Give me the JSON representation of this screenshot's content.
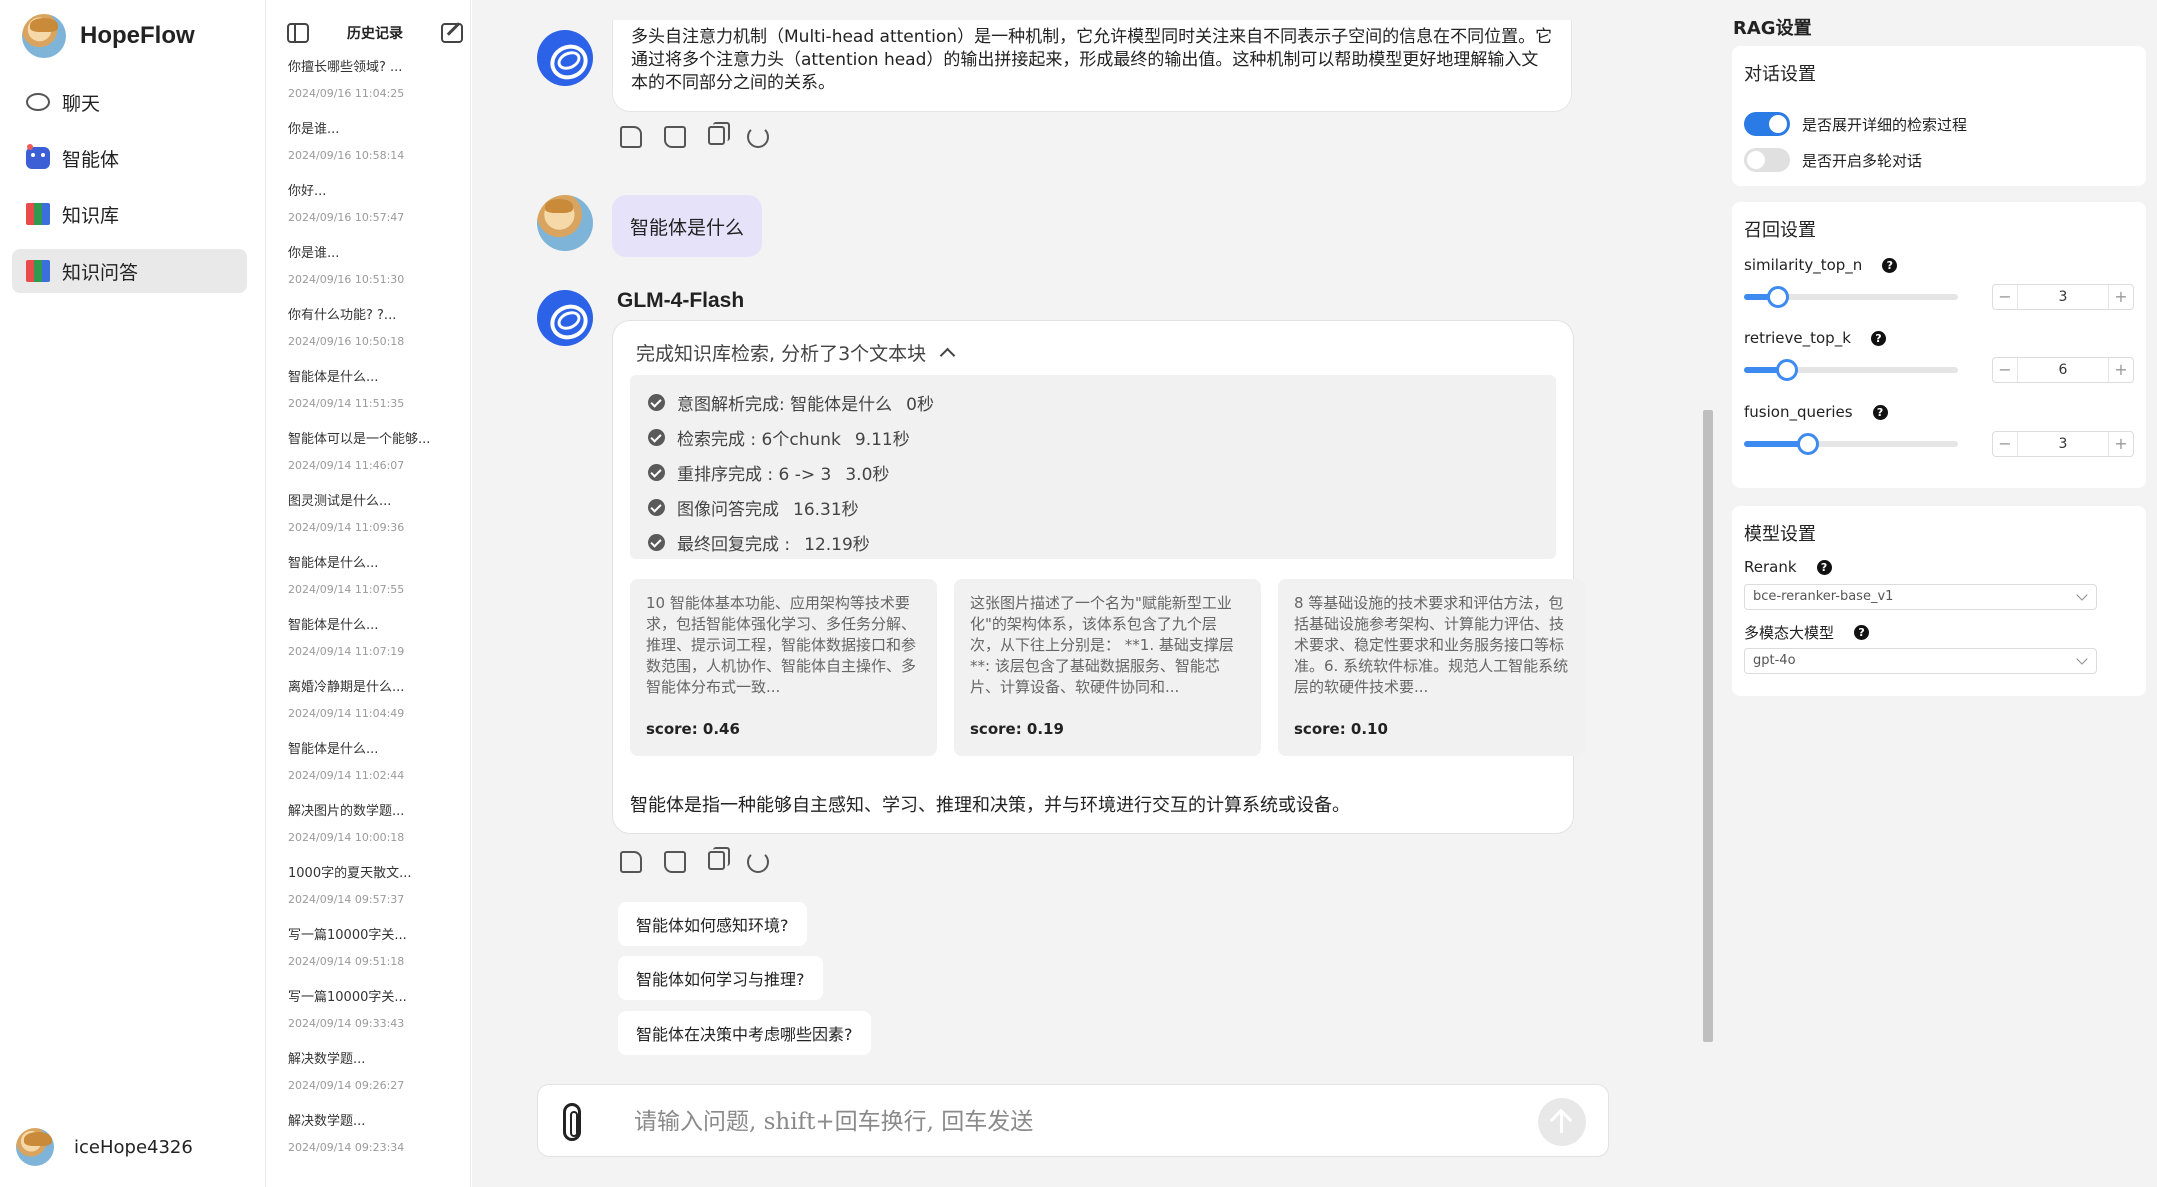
{
  "app": {
    "name": "HopeFlow"
  },
  "nav": {
    "items": [
      {
        "label": "聊天",
        "icon": "chat-icon"
      },
      {
        "label": "智能体",
        "icon": "robot-icon"
      },
      {
        "label": "知识库",
        "icon": "books-icon"
      },
      {
        "label": "知识问答",
        "icon": "books-icon",
        "active": true
      }
    ],
    "user": "iceHope4326"
  },
  "history": {
    "title": "历史记录",
    "items": [
      {
        "q": "你擅长哪些领域? ...",
        "t": "2024/09/16 11:04:25"
      },
      {
        "q": "你是谁...",
        "t": "2024/09/16 10:58:14"
      },
      {
        "q": "你好...",
        "t": "2024/09/16 10:57:47"
      },
      {
        "q": "你是谁...",
        "t": "2024/09/16 10:51:30"
      },
      {
        "q": "你有什么功能? ?...",
        "t": "2024/09/16 10:50:18"
      },
      {
        "q": "智能体是什么...",
        "t": "2024/09/14 11:51:35"
      },
      {
        "q": "智能体可以是一个能够...",
        "t": "2024/09/14 11:46:07"
      },
      {
        "q": "图灵测试是什么...",
        "t": "2024/09/14 11:09:36"
      },
      {
        "q": "智能体是什么...",
        "t": "2024/09/14 11:07:55"
      },
      {
        "q": "智能体是什么...",
        "t": "2024/09/14 11:07:19"
      },
      {
        "q": "离婚冷静期是什么...",
        "t": "2024/09/14 11:04:49"
      },
      {
        "q": "智能体是什么...",
        "t": "2024/09/14 11:02:44"
      },
      {
        "q": "解决图片的数学题...",
        "t": "2024/09/14 10:00:18"
      },
      {
        "q": "1000字的夏天散文...",
        "t": "2024/09/14 09:57:37"
      },
      {
        "q": "写一篇10000字关...",
        "t": "2024/09/14 09:51:18"
      },
      {
        "q": "写一篇10000字关...",
        "t": "2024/09/14 09:33:43"
      },
      {
        "q": "解决数学题...",
        "t": "2024/09/14 09:26:27"
      },
      {
        "q": "解决数学题...",
        "t": "2024/09/14 09:23:34"
      }
    ]
  },
  "chat": {
    "prev_answer": "多头自注意力机制（Multi-head attention）是一种机制，它允许模型同时关注来自不同表示子空间的信息在不同位置。它通过将多个注意力头（attention head）的输出拼接起来，形成最终的输出值。这种机制可以帮助模型更好地理解输入文本的不同部分之间的关系。",
    "user_question": "智能体是什么",
    "model_name": "GLM-4-Flash",
    "search_summary": "完成知识库检索, 分析了3个文本块",
    "steps": [
      {
        "label": "意图解析完成: 智能体是什么",
        "time": "0秒"
      },
      {
        "label": "检索完成 : 6个chunk",
        "time": "9.11秒"
      },
      {
        "label": "重排序完成 : 6 -> 3",
        "time": "3.0秒"
      },
      {
        "label": "图像问答完成",
        "time": "16.31秒"
      },
      {
        "label": "最终回复完成 :",
        "time": "12.19秒"
      }
    ],
    "chunks": [
      {
        "text": "10 智能体基本功能、应用架构等技术要求，包括智能体强化学习、多任务分解、推理、提示词工程，智能体数据接口和参数范围，人机协作、智能体自主操作、多智能体分布式一致...",
        "score": "score: 0.46"
      },
      {
        "text": "这张图片描述了一个名为\"赋能新型工业化\"的架构体系，该体系包含了九个层次，从下往上分别是： **1. 基础支撑层**: 该层包含了基础数据服务、智能芯片、计算设备、软硬件协同和...",
        "score": "score: 0.19"
      },
      {
        "text": "8 等基础设施的技术要求和评估方法，包括基础设施参考架构、计算能力评估、技术要求、稳定性要求和业务服务接口等标准。6. 系统软件标准。规范人工智能系统层的软硬件技术要...",
        "score": "score: 0.10"
      }
    ],
    "answer": "智能体是指一种能够自主感知、学习、推理和决策，并与环境进行交互的计算系统或设备。",
    "suggestions": [
      "智能体如何感知环境?",
      "智能体如何学习与推理?",
      "智能体在决策中考虑哪些因素?"
    ],
    "input_placeholder": "请输入问题, shift+回车换行, 回车发送"
  },
  "rag": {
    "title": "RAG设置",
    "dialog": {
      "title": "对话设置",
      "toggles": [
        {
          "label": "是否展开详细的检索过程",
          "on": true
        },
        {
          "label": "是否开启多轮对话",
          "on": false
        }
      ]
    },
    "recall": {
      "title": "召回设置",
      "params": [
        {
          "label": "similarity_top_n",
          "value": "3",
          "fraction": 0.16
        },
        {
          "label": "retrieve_top_k",
          "value": "6",
          "fraction": 0.2
        },
        {
          "label": "fusion_queries",
          "value": "3",
          "fraction": 0.3
        }
      ]
    },
    "model": {
      "title": "模型设置",
      "rerank_label": "Rerank",
      "rerank_value": "bce-reranker-base_v1",
      "mm_label": "多模态大模型",
      "mm_value": "gpt-4o"
    }
  },
  "colors": {
    "accent": "#2a7be6",
    "user_bubble": "#e6e2fa",
    "bot_avatar": "#2b62e8"
  }
}
